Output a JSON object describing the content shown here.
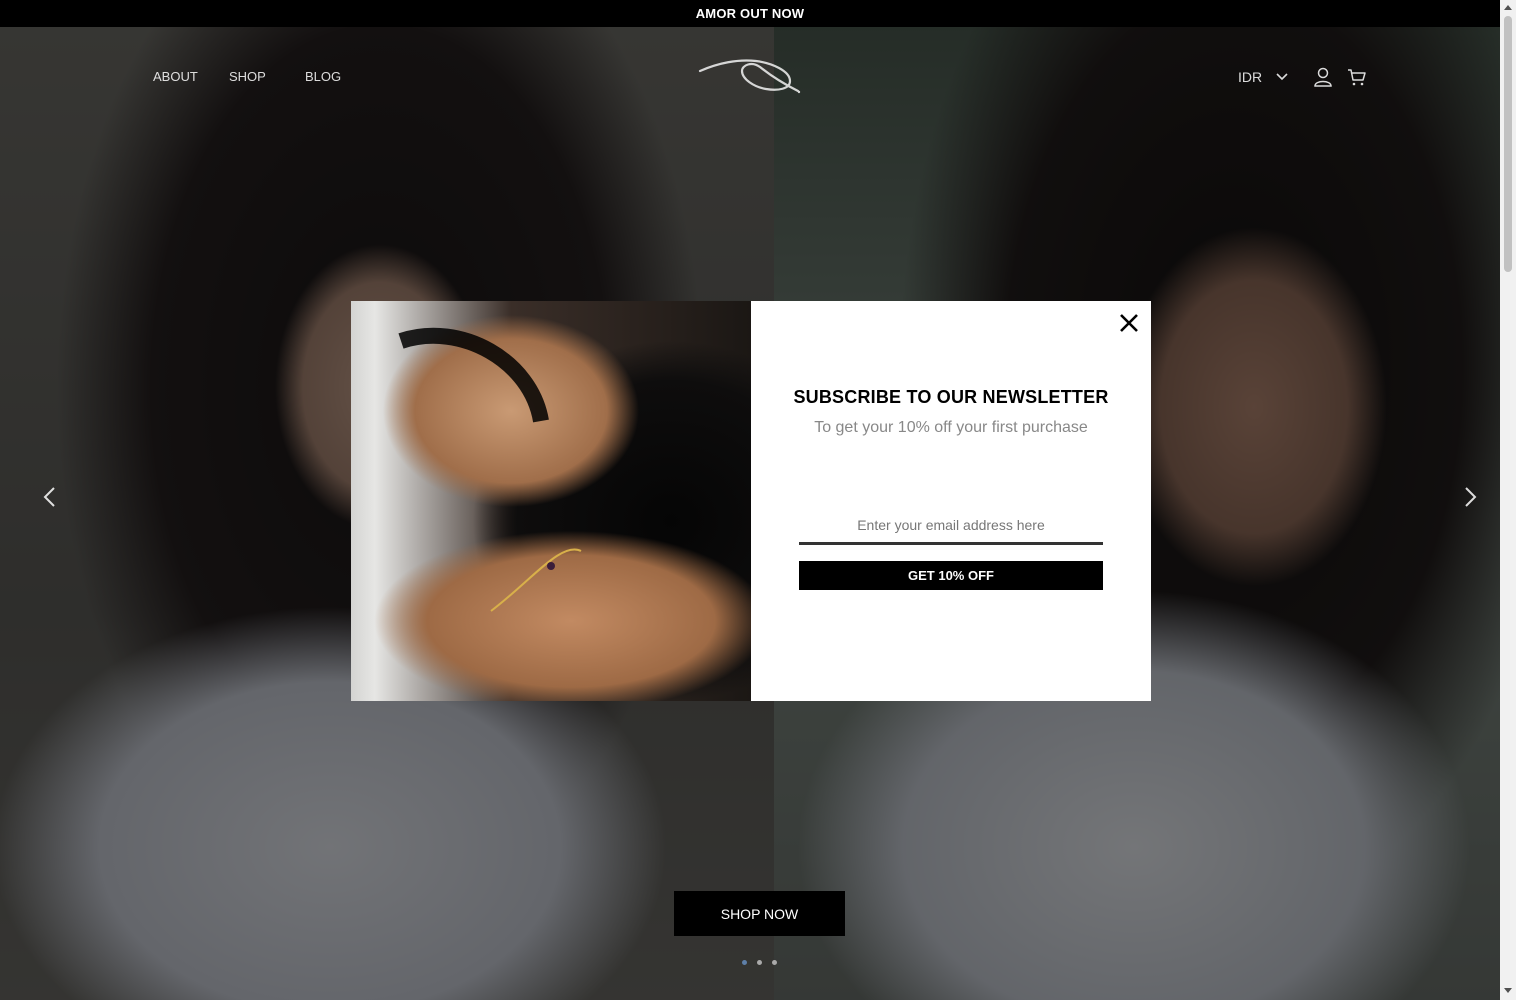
{
  "announcement": "AMOR OUT NOW",
  "nav": {
    "links": [
      "ABOUT",
      "SHOP",
      "BLOG"
    ],
    "currency": "IDR",
    "icons": [
      "account-icon",
      "cart-icon"
    ]
  },
  "hero": {
    "cta_label": "SHOP NOW",
    "slides_count": 3,
    "active_slide": 1
  },
  "popup": {
    "title": "SUBSCRIBE TO OUR NEWSLETTER",
    "subtitle": "To get your 10% off your first purchase",
    "email_placeholder": "Enter your email address here",
    "button_label": "GET 10% OFF"
  },
  "colors": {
    "bar": "#000000",
    "dot_active": "#5e7fa8"
  }
}
